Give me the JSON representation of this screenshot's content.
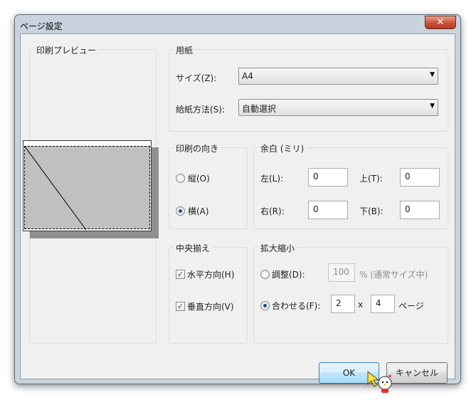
{
  "window": {
    "title": "ページ設定",
    "close_symbol": "✕"
  },
  "preview": {
    "group_title": "印刷プレビュー"
  },
  "paper": {
    "group_title": "用紙",
    "size_label": "サイズ(Z):",
    "size_value": "A4",
    "source_label": "給紙方法(S):",
    "source_value": "自動選択"
  },
  "orientation": {
    "group_title": "印刷の向き",
    "portrait_label": "縦(O)",
    "landscape_label": "横(A)",
    "selected": "landscape"
  },
  "margins": {
    "group_title": "余白 (ミリ)",
    "left_label": "左(L):",
    "left_value": "0",
    "top_label": "上(T):",
    "top_value": "0",
    "right_label": "右(R):",
    "right_value": "0",
    "bottom_label": "下(B):",
    "bottom_value": "0"
  },
  "centering": {
    "group_title": "中央揃え",
    "horizontal_label": "水平方向(H)",
    "horizontal_checked": true,
    "vertical_label": "垂直方向(V)",
    "vertical_checked": true
  },
  "scaling": {
    "group_title": "拡大縮小",
    "adjust_label": "調整(D):",
    "adjust_value": "100",
    "adjust_suffix": "% (通常サイズ中)",
    "fit_label": "合わせる(F):",
    "fit_wide": "2",
    "fit_x": "x",
    "fit_tall": "4",
    "fit_suffix": "ページ",
    "selected": "fit"
  },
  "buttons": {
    "ok": "OK",
    "cancel": "キャンセル"
  },
  "check_symbol": "✓",
  "arrow_symbol": "▼"
}
